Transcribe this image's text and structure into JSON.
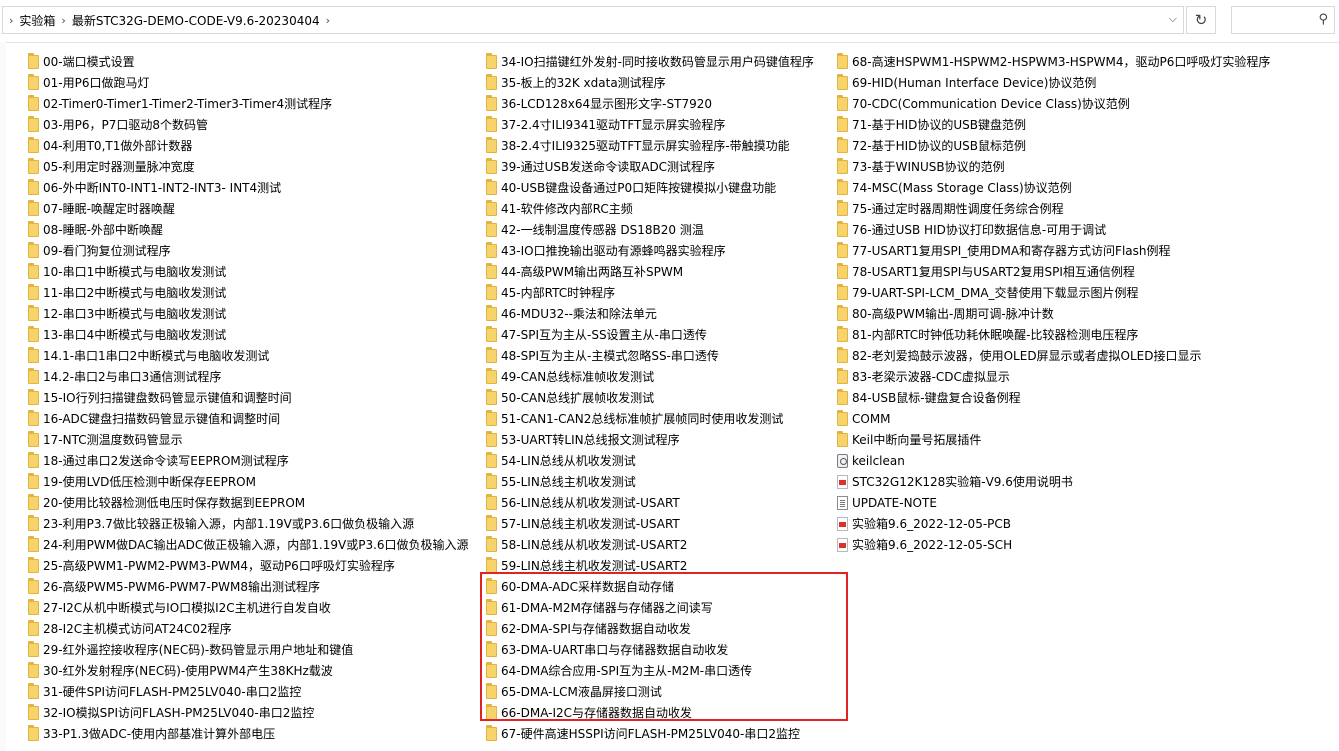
{
  "address": {
    "breadcrumbs": [
      "实验箱",
      "最新STC32G-DEMO-CODE-V9.6-20230404"
    ],
    "search_placeholder": ""
  },
  "files": {
    "col1": [
      "00-端口模式设置",
      "01-用P6口做跑马灯",
      "02-Timer0-Timer1-Timer2-Timer3-Timer4测试程序",
      "03-用P6，P7口驱动8个数码管",
      "04-利用T0,T1做外部计数器",
      "05-利用定时器测量脉冲宽度",
      "06-外中断INT0-INT1-INT2-INT3- INT4测试",
      "07-睡眠-唤醒定时器唤醒",
      "08-睡眠-外部中断唤醒",
      "09-看门狗复位测试程序",
      "10-串口1中断模式与电脑收发测试",
      "11-串口2中断模式与电脑收发测试",
      "12-串口3中断模式与电脑收发测试",
      "13-串口4中断模式与电脑收发测试",
      "14.1-串口1串口2中断模式与电脑收发测试",
      "14.2-串口2与串口3通信测试程序",
      "15-IO行列扫描键盘数码管显示键值和调整时间",
      "16-ADC键盘扫描数码管显示键值和调整时间",
      "17-NTC测温度数码管显示",
      "18-通过串口2发送命令读写EEPROM测试程序",
      "19-使用LVD低压检测中断保存EEPROM",
      "20-使用比较器检测低电压时保存数据到EEPROM",
      "23-利用P3.7做比较器正极输入源，内部1.19V或P3.6口做负极输入源",
      "24-利用PWM做DAC输出ADC做正极输入源，内部1.19V或P3.6口做负极输入源",
      "25-高级PWM1-PWM2-PWM3-PWM4，驱动P6口呼吸灯实验程序",
      "26-高级PWM5-PWM6-PWM7-PWM8输出测试程序",
      "27-I2C从机中断模式与IO口模拟I2C主机进行自发自收",
      "28-I2C主机模式访问AT24C02程序",
      "29-红外遥控接收程序(NEC码)-数码管显示用户地址和键值",
      "30-红外发射程序(NEC码)-使用PWM4产生38KHz载波",
      "31-硬件SPI访问FLASH-PM25LV040-串口2监控",
      "32-IO模拟SPI访问FLASH-PM25LV040-串口2监控",
      "33-P1.3做ADC-使用内部基准计算外部电压"
    ],
    "col2": [
      "34-IO扫描键红外发射-同时接收数码管显示用户码键值程序",
      "35-板上的32K xdata测试程序",
      "36-LCD128x64显示图形文字-ST7920",
      "37-2.4寸ILI9341驱动TFT显示屏实验程序",
      "38-2.4寸ILI9325驱动TFT显示屏实验程序-带触摸功能",
      "39-通过USB发送命令读取ADC测试程序",
      "40-USB键盘设备通过P0口矩阵按键模拟小键盘功能",
      "41-软件修改内部RC主频",
      "42-一线制温度传感器 DS18B20 测温",
      "43-IO口推挽输出驱动有源蜂鸣器实验程序",
      "44-高级PWM输出两路互补SPWM",
      "45-内部RTC时钟程序",
      "46-MDU32--乘法和除法单元",
      "47-SPI互为主从-SS设置主从-串口透传",
      "48-SPI互为主从-主模式忽略SS-串口透传",
      "49-CAN总线标准帧收发测试",
      "50-CAN总线扩展帧收发测试",
      "51-CAN1-CAN2总线标准帧扩展帧同时使用收发测试",
      "53-UART转LIN总线报文测试程序",
      "54-LIN总线从机收发测试",
      "55-LIN总线主机收发测试",
      "56-LIN总线从机收发测试-USART",
      "57-LIN总线主机收发测试-USART",
      "58-LIN总线从机收发测试-USART2",
      "59-LIN总线主机收发测试-USART2",
      "60-DMA-ADC采样数据自动存储",
      "61-DMA-M2M存储器与存储器之间读写",
      "62-DMA-SPI与存储器数据自动收发",
      "63-DMA-UART串口与存储器数据自动收发",
      "64-DMA综合应用-SPI互为主从-M2M-串口透传",
      "65-DMA-LCM液晶屏接口测试",
      "66-DMA-I2C与存储器数据自动收发",
      "67-硬件高速HSSPI访问FLASH-PM25LV040-串口2监控"
    ],
    "col3": [
      {
        "name": "68-高速HSPWM1-HSPWM2-HSPWM3-HSPWM4，驱动P6口呼吸灯实验程序",
        "icon": "folder"
      },
      {
        "name": "69-HID(Human Interface Device)协议范例",
        "icon": "folder"
      },
      {
        "name": "70-CDC(Communication Device Class)协议范例",
        "icon": "folder"
      },
      {
        "name": "71-基于HID协议的USB键盘范例",
        "icon": "folder"
      },
      {
        "name": "72-基于HID协议的USB鼠标范例",
        "icon": "folder"
      },
      {
        "name": "73-基于WINUSB协议的范例",
        "icon": "folder"
      },
      {
        "name": "74-MSC(Mass Storage Class)协议范例",
        "icon": "folder"
      },
      {
        "name": "75-通过定时器周期性调度任务综合例程",
        "icon": "folder"
      },
      {
        "name": "76-通过USB HID协议打印数据信息-可用于调试",
        "icon": "folder"
      },
      {
        "name": "77-USART1复用SPI_使用DMA和寄存器方式访问Flash例程",
        "icon": "folder"
      },
      {
        "name": "78-USART1复用SPI与USART2复用SPI相互通信例程",
        "icon": "folder"
      },
      {
        "name": "79-UART-SPI-LCM_DMA_交替使用下载显示图片例程",
        "icon": "folder"
      },
      {
        "name": "80-高级PWM输出-周期可调-脉冲计数",
        "icon": "folder"
      },
      {
        "name": "81-内部RTC时钟低功耗休眠唤醒-比较器检测电压程序",
        "icon": "folder"
      },
      {
        "name": "82-老刘爱捣鼓示波器，使用OLED屏显示或者虚拟OLED接口显示",
        "icon": "folder"
      },
      {
        "name": "83-老梁示波器-CDC虚拟显示",
        "icon": "folder"
      },
      {
        "name": "84-USB鼠标-键盘复合设备例程",
        "icon": "folder"
      },
      {
        "name": "COMM",
        "icon": "folder"
      },
      {
        "name": "Keil中断向量号拓展插件",
        "icon": "folder"
      },
      {
        "name": "keilclean",
        "icon": "app"
      },
      {
        "name": "STC32G12K128实验箱-V9.6使用说明书",
        "icon": "pdf"
      },
      {
        "name": "UPDATE-NOTE",
        "icon": "txt"
      },
      {
        "name": "实验箱9.6_2022-12-05-PCB",
        "icon": "pdf"
      },
      {
        "name": "实验箱9.6_2022-12-05-SCH",
        "icon": "pdf"
      }
    ]
  },
  "colors": {
    "folder": "#f6d36b",
    "highlight": "#e02424"
  }
}
